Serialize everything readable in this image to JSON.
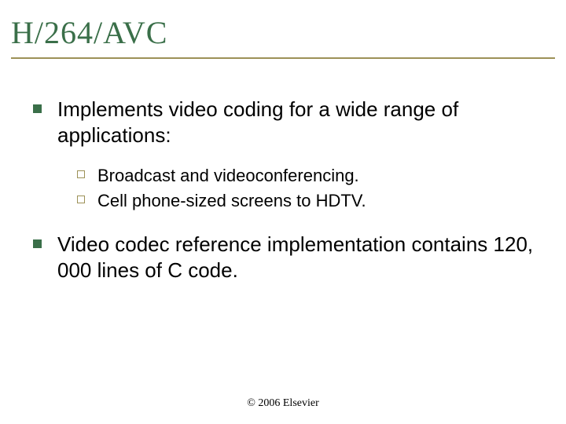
{
  "title": "H/264/AVC",
  "bullets": [
    {
      "text": "Implements video coding for a wide range of applications:",
      "sub": [
        "Broadcast and videoconferencing.",
        "Cell phone-sized screens to HDTV."
      ]
    },
    {
      "text": "Video codec reference implementation contains 120, 000 lines of C code.",
      "sub": []
    }
  ],
  "footer": "© 2006 Elsevier"
}
